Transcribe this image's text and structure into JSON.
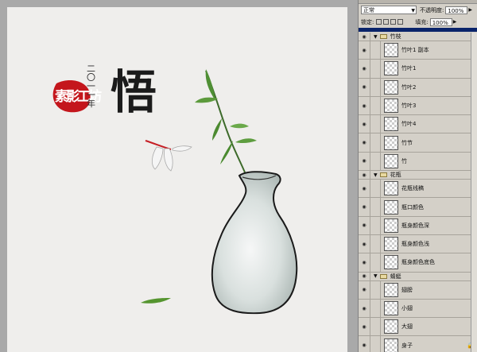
{
  "canvas": {
    "big_char": "悟",
    "vertical_text": "二〇一一年",
    "seal_text": "素影工坊"
  },
  "panel": {
    "blend_mode": "正常",
    "opacity_label": "不透明度:",
    "opacity_value": "100%",
    "lock_label": "锁定:",
    "fill_label": "填充:",
    "fill_value": "100%"
  },
  "layers": [
    {
      "type": "group",
      "name": "竹枝"
    },
    {
      "type": "layer",
      "name": "竹叶1 副本"
    },
    {
      "type": "layer",
      "name": "竹叶1"
    },
    {
      "type": "layer",
      "name": "竹叶2"
    },
    {
      "type": "layer",
      "name": "竹叶3"
    },
    {
      "type": "layer",
      "name": "竹叶4"
    },
    {
      "type": "layer",
      "name": "竹节"
    },
    {
      "type": "layer",
      "name": "竹"
    },
    {
      "type": "group",
      "name": "花瓶"
    },
    {
      "type": "layer",
      "name": "花瓶线稿"
    },
    {
      "type": "layer",
      "name": "瓶口颜色"
    },
    {
      "type": "layer",
      "name": "瓶身颜色深"
    },
    {
      "type": "layer",
      "name": "瓶身颜色浅"
    },
    {
      "type": "layer",
      "name": "瓶身颜色底色"
    },
    {
      "type": "group",
      "name": "蜻蜓"
    },
    {
      "type": "layer",
      "name": "翅膀"
    },
    {
      "type": "layer",
      "name": "小翅"
    },
    {
      "type": "layer",
      "name": "大翅"
    },
    {
      "type": "layer",
      "name": "身子",
      "locked": true
    }
  ]
}
